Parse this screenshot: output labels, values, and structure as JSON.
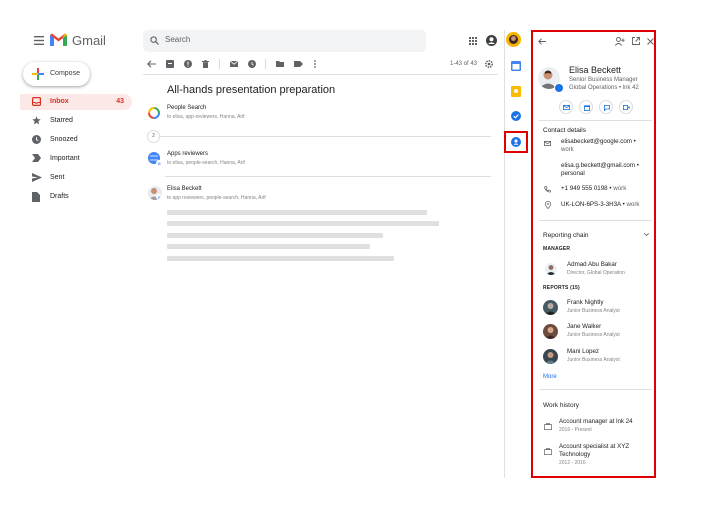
{
  "app": {
    "name": "Gmail"
  },
  "search": {
    "placeholder": "Search"
  },
  "sidebar": {
    "compose_label": "Compose",
    "items": [
      {
        "label": "Inbox",
        "count": "43",
        "icon": "inbox-icon"
      },
      {
        "label": "Starred",
        "count": "",
        "icon": "star-icon"
      },
      {
        "label": "Snoozed",
        "count": "",
        "icon": "clock-icon"
      },
      {
        "label": "Important",
        "count": "",
        "icon": "important-icon"
      },
      {
        "label": "Sent",
        "count": "",
        "icon": "send-icon"
      },
      {
        "label": "Drafts",
        "count": "",
        "icon": "draft-icon"
      }
    ]
  },
  "toolbar": {
    "pager": "1-43 of 43"
  },
  "thread": {
    "subject": "All-hands presentation preparation",
    "collapsed_count": "2",
    "messages": [
      {
        "sender": "People Search",
        "to": "to elisa, app-reviewers, Hanna, Arif"
      },
      {
        "sender": "Apps reviewers",
        "to": "to elisa, people-search, Hanna, Arif"
      },
      {
        "sender": "Elisa Beckett",
        "to": "to app reviewers, people-search, Hanna, Arif"
      }
    ]
  },
  "panel": {
    "name": "Elisa Beckett",
    "title": "Senior Business Manager",
    "location": "Global Operations • lnk 42",
    "contact_heading": "Contact details",
    "emails": [
      {
        "address": "elisabeckett@google.com",
        "type": "work"
      },
      {
        "address": "elisa.g.beckett@gmail.com",
        "type": "personal"
      }
    ],
    "phone": {
      "number": "+1 949 555 0198",
      "type": "work"
    },
    "desk": {
      "location": "UK-LON-6PS-3-3H3A",
      "type": "work"
    },
    "reporting_heading": "Reporting chain",
    "manager_caption": "MANAGER",
    "manager": {
      "name": "Admad Abu Bakar",
      "role": "Director, Global Operation"
    },
    "reports_caption": "REPORTS (15)",
    "reports": [
      {
        "name": "Frank Nightly",
        "role": "Junior Business Analyst"
      },
      {
        "name": "Jane Walker",
        "role": "Junior Business Analyst"
      },
      {
        "name": "Mani Lopez",
        "role": "Junior Business Analyst"
      }
    ],
    "more_label": "More",
    "history_heading": "Work history",
    "history": [
      {
        "role": "Account manager at lnk 24",
        "years": "2016 - Present"
      },
      {
        "role": "Account specialist at XYZ",
        "role2": "Technology",
        "years": "2012 - 2016"
      }
    ]
  },
  "colors": {
    "accent_red": "#d93025",
    "highlight": "#e00000",
    "link_blue": "#1a73e8"
  }
}
